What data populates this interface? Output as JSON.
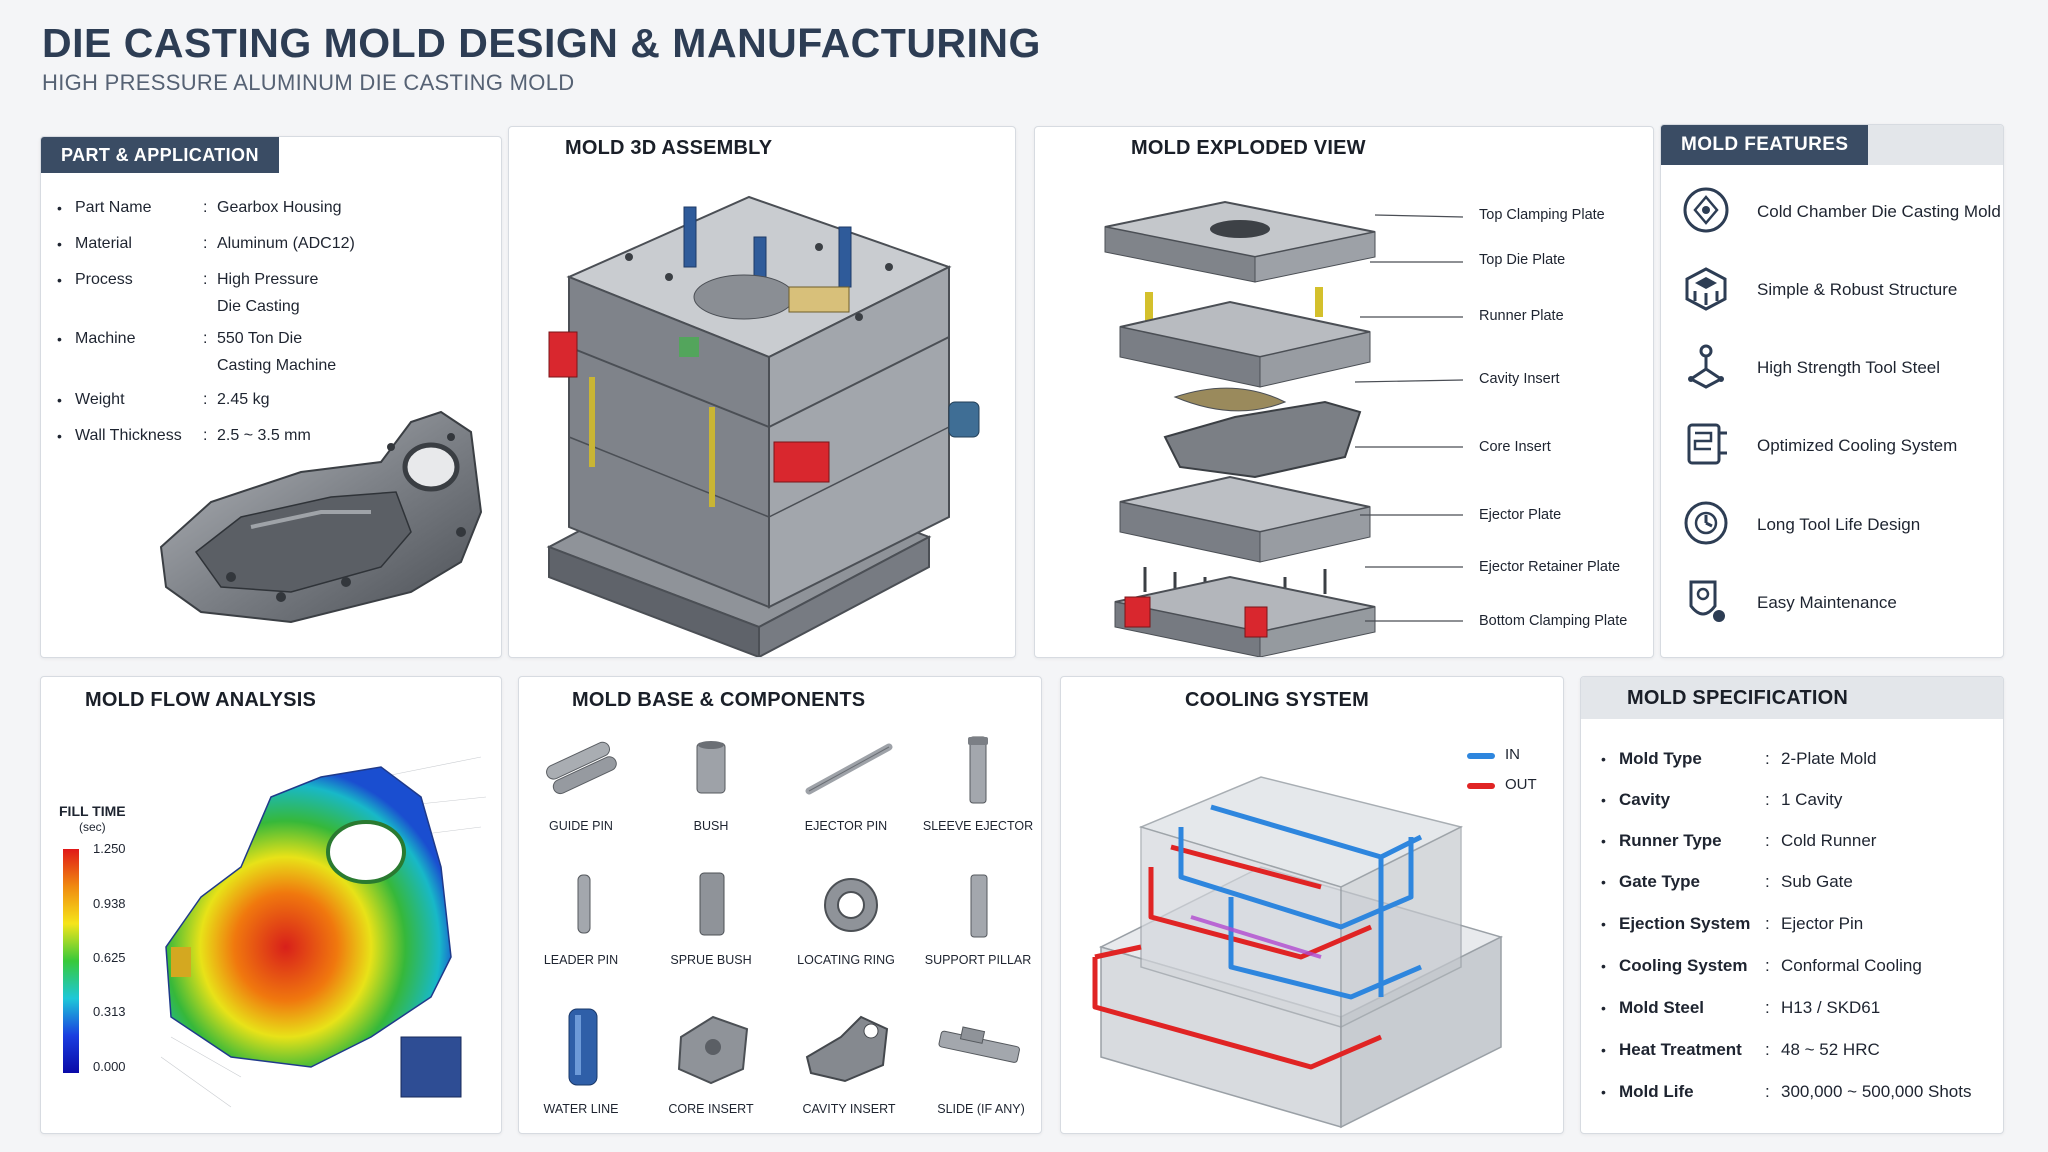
{
  "header": {
    "title": "DIE CASTING MOLD DESIGN & MANUFACTURING",
    "subtitle": "HIGH PRESSURE ALUMINUM DIE CASTING MOLD"
  },
  "part": {
    "tab": "PART & APPLICATION",
    "rows": [
      {
        "label": "Part Name",
        "value": "Gearbox Housing",
        "value2": ""
      },
      {
        "label": "Material",
        "value": "Aluminum (ADC12)",
        "value2": ""
      },
      {
        "label": "Process",
        "value": "High Pressure",
        "value2": "Die Casting"
      },
      {
        "label": "Machine",
        "value": "550 Ton Die",
        "value2": "Casting Machine"
      },
      {
        "label": "Weight",
        "value": "2.45 kg",
        "value2": ""
      },
      {
        "label": "Wall Thickness",
        "value": "2.5 ~ 3.5 mm",
        "value2": ""
      }
    ]
  },
  "assembly": {
    "title": "MOLD 3D ASSEMBLY"
  },
  "exploded": {
    "title": "MOLD EXPLODED VIEW",
    "labels": [
      "Top Clamping Plate",
      "Top Die Plate",
      "Runner Plate",
      "Cavity Insert",
      "Core Insert",
      "Ejector Plate",
      "Ejector Retainer Plate",
      "Bottom Clamping Plate"
    ]
  },
  "features": {
    "tab": "MOLD FEATURES",
    "items": [
      {
        "label": "Cold Chamber Die Casting Mold",
        "icon": "die-casting-icon"
      },
      {
        "label": "Simple & Robust Structure",
        "icon": "structure-icon"
      },
      {
        "label": "High Strength Tool Steel",
        "icon": "tool-steel-icon"
      },
      {
        "label": "Optimized Cooling System",
        "icon": "cooling-icon"
      },
      {
        "label": "Long Tool Life Design",
        "icon": "tool-life-icon"
      },
      {
        "label": "Easy Maintenance",
        "icon": "maintenance-icon"
      }
    ]
  },
  "flow": {
    "title": "MOLD FLOW ANALYSIS",
    "legend_title": "FILL TIME",
    "legend_unit": "(sec)",
    "ticks": [
      "1.250",
      "0.938",
      "0.625",
      "0.313",
      "0.000"
    ]
  },
  "components": {
    "title": "MOLD BASE & COMPONENTS",
    "items": [
      "GUIDE PIN",
      "BUSH",
      "EJECTOR PIN",
      "SLEEVE EJECTOR",
      "LEADER PIN",
      "SPRUE BUSH",
      "LOCATING RING",
      "SUPPORT PILLAR",
      "WATER LINE",
      "CORE INSERT",
      "CAVITY INSERT",
      "SLIDE (IF ANY)"
    ]
  },
  "cooling": {
    "title": "COOLING SYSTEM",
    "legend_in": "IN",
    "legend_out": "OUT",
    "color_in": "#2e86de",
    "color_out": "#e02424"
  },
  "spec": {
    "title": "MOLD SPECIFICATION",
    "rows": [
      {
        "label": "Mold Type",
        "value": "2-Plate Mold"
      },
      {
        "label": "Cavity",
        "value": "1 Cavity"
      },
      {
        "label": "Runner Type",
        "value": "Cold Runner"
      },
      {
        "label": "Gate Type",
        "value": "Sub Gate"
      },
      {
        "label": "Ejection System",
        "value": "Ejector Pin"
      },
      {
        "label": "Cooling System",
        "value": "Conformal Cooling"
      },
      {
        "label": "Mold Steel",
        "value": "H13 / SKD61"
      },
      {
        "label": "Heat Treatment",
        "value": "48 ~ 52 HRC"
      },
      {
        "label": "Mold Life",
        "value": "300,000 ~ 500,000 Shots"
      }
    ]
  }
}
